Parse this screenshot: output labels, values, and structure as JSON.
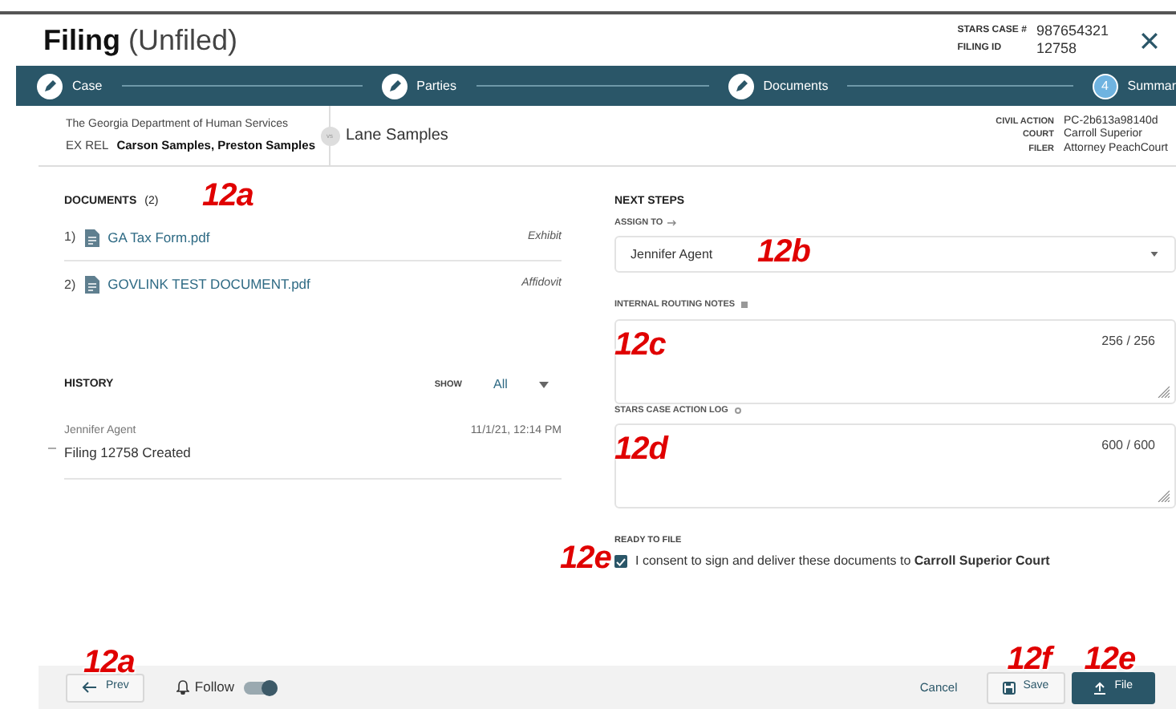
{
  "header": {
    "title": "Filing",
    "status": "(Unfiled)",
    "case_label": "STARS CASE #",
    "case_number": "987654321",
    "filing_label": "FILING ID",
    "filing_id": "12758"
  },
  "stepper": [
    {
      "label": "Case",
      "kind": "done"
    },
    {
      "label": "Parties",
      "kind": "done"
    },
    {
      "label": "Documents",
      "kind": "done"
    },
    {
      "label": "Summar",
      "kind": "current",
      "number": "4"
    }
  ],
  "parties": {
    "plaintiff": "The Georgia Department of Human Services",
    "ex_rel_label": "EX REL",
    "ex_rel": "Carson Samples, Preston Samples",
    "vs": "vs",
    "defendant": "Lane Samples"
  },
  "case_info": [
    {
      "label": "CIVIL ACTION",
      "value": "PC-2b613a98140d"
    },
    {
      "label": "COURT",
      "value": "Carroll Superior"
    },
    {
      "label": "FILER",
      "value": "Attorney PeachCourt"
    }
  ],
  "documents": {
    "title": "DOCUMENTS",
    "count": "(2)",
    "callout": "12a",
    "items": [
      {
        "number": "1)",
        "name": "GA Tax Form.pdf",
        "type": "Exhibit"
      },
      {
        "number": "2)",
        "name": "GOVLINK TEST DOCUMENT.pdf",
        "type": "Affidovit"
      }
    ]
  },
  "history": {
    "title": "HISTORY",
    "show_label": "SHOW",
    "show_value": "All",
    "items": [
      {
        "user": "Jennifer Agent",
        "time": "11/1/21, 12:14 PM",
        "event": "Filing 12758 Created"
      }
    ]
  },
  "next_steps": {
    "title": "NEXT STEPS",
    "assign_label": "ASSIGN TO",
    "assign_value": "Jennifer Agent",
    "assign_callout": "12b",
    "notes": [
      {
        "label": "INTERNAL ROUTING NOTES",
        "counter": "256 / 256",
        "callout": "12c"
      },
      {
        "label": "STARS CASE ACTION LOG",
        "counter": "600 / 600",
        "callout": "12d"
      }
    ],
    "ready_label": "READY TO FILE",
    "consent": "I consent to sign and deliver these documents to **Carroll Superior Court**",
    "consent_checked": true,
    "consent_callout": "12e"
  },
  "footer": {
    "prev": "Prev",
    "prev_callout": "12a",
    "follow": "Follow",
    "follow_on": true,
    "cancel": "Cancel",
    "save": "Save",
    "save_callout": "12f",
    "file": "File",
    "file_callout": "12e"
  }
}
